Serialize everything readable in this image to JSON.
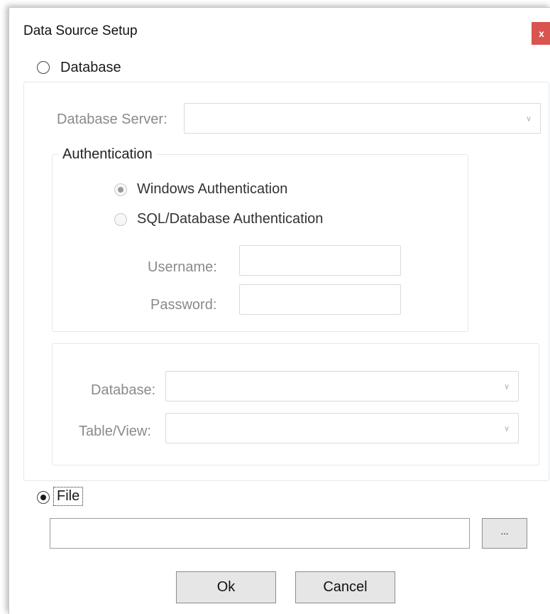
{
  "dialog": {
    "title": "Data Source Setup",
    "close_label": "x"
  },
  "database_option": {
    "label": "Database",
    "selected": false,
    "server": {
      "label": "Database Server:",
      "value": ""
    },
    "authentication": {
      "group_label": "Authentication",
      "windows_auth_label": "Windows Authentication",
      "windows_auth_selected": true,
      "sql_auth_label": "SQL/Database Authentication",
      "sql_auth_selected": false,
      "username_label": "Username:",
      "username_value": "",
      "password_label": "Password:",
      "password_value": ""
    },
    "database_label": "Database:",
    "database_value": "",
    "table_view_label": "Table/View:",
    "table_view_value": ""
  },
  "file_option": {
    "label": "File",
    "selected": true,
    "path_value": "",
    "browse_label": "..."
  },
  "buttons": {
    "ok_label": "Ok",
    "cancel_label": "Cancel"
  },
  "colors": {
    "close_button_bg": "#d9534f",
    "disabled_text": "#8a8a8a",
    "button_bg": "#e6e6e6"
  }
}
